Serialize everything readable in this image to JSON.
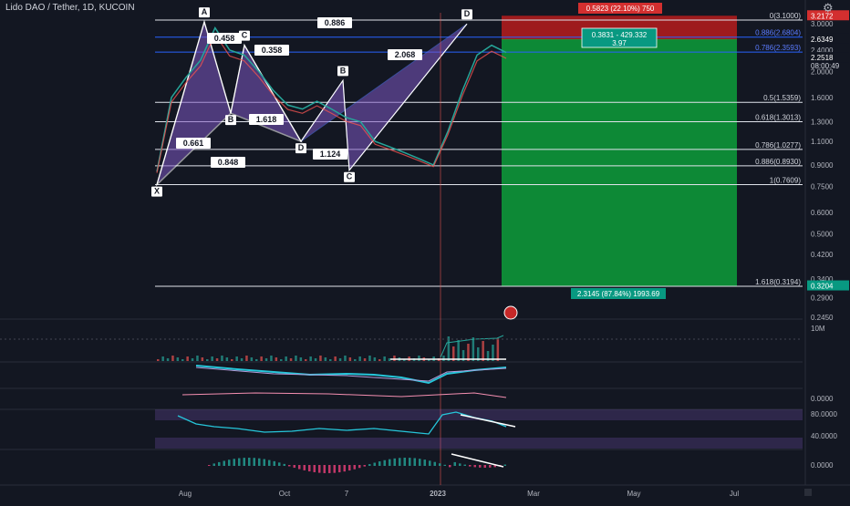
{
  "header": {
    "title": "Lido DAO / Tether, 1D, KUCOIN",
    "gear_icon": "gear-icon"
  },
  "clock": "08:00:49",
  "colors": {
    "background": "#131722",
    "harmonic_fill": "#7e57c2",
    "stop_zone": "#b71c1c",
    "target_zone": "#0d9e3a",
    "price_tag": "#d32f2f",
    "target_tag": "#089981",
    "fib_line": "#ffffff",
    "fib_line_blue": "#2962ff",
    "rsi_line": "#26c6da",
    "volume_line": "#26a69a"
  },
  "position": {
    "stop_label": "0.5823 (22.10%) 750",
    "entry_label_line1": "0.3831 - 429.332",
    "entry_label_line2": "3.97",
    "target_label": "2.3145 (87.84%) 1993.69"
  },
  "chart_data": {
    "type": "line",
    "title": "Lido DAO / Tether, 1D, KUCOIN",
    "y_scale": "log",
    "ylim": [
      0.245,
      3.3
    ],
    "price_axis_ticks": [
      "3.0000",
      "2.4000",
      "2.0000",
      "1.6000",
      "1.3000",
      "1.1000",
      "0.9000",
      "0.7500",
      "0.6000",
      "0.5000",
      "0.4200",
      "0.3400",
      "0.2900",
      "0.2450"
    ],
    "price_markers": [
      {
        "label": "3.2172",
        "color": "#d32f2f",
        "value": 3.2172
      },
      {
        "label": "2.6349",
        "color": "#131722",
        "value": 2.6349
      },
      {
        "label": "2.2518",
        "color": "#131722",
        "value": 2.2518
      },
      {
        "label": "0.3204",
        "color": "#089981",
        "value": 0.3204
      }
    ],
    "x_tick_labels": [
      "Aug",
      "Oct",
      "7",
      "2023",
      "Mar",
      "May",
      "Jul"
    ],
    "fib_levels": [
      {
        "label": "0(3.1000)",
        "value": 3.1
      },
      {
        "label": "0.886(2.6804)",
        "value": 2.6804,
        "color": "blue"
      },
      {
        "label": "0.786(2.3593)",
        "value": 2.3593,
        "color": "blue"
      },
      {
        "label": "0.5(1.5359)",
        "value": 1.5359
      },
      {
        "label": "0.618(1.3013)",
        "value": 1.3013
      },
      {
        "label": "0.786(1.0277)",
        "value": 1.0277
      },
      {
        "label": "0.886(0.8930)",
        "value": 0.893
      },
      {
        "label": "1(0.7609)",
        "value": 0.7609
      },
      {
        "label": "1.618(0.3194)",
        "value": 0.3194
      }
    ],
    "pattern_points": [
      {
        "label": "X",
        "value": 0.76
      },
      {
        "label": "A",
        "value": 3.05
      },
      {
        "label": "B",
        "value": 1.4
      },
      {
        "label": "C",
        "value": 2.5
      },
      {
        "label": "D",
        "value": 1.1
      },
      {
        "label": "B",
        "value": 1.85
      },
      {
        "label": "C",
        "value": 0.86
      },
      {
        "label": "D",
        "value": 3.0
      }
    ],
    "pattern_ratios": [
      "0.458",
      "1.618",
      "0.661",
      "0.848",
      "0.358",
      "1.124",
      "2.068",
      "0.886"
    ],
    "close_series": {
      "x": [
        "Jun 15",
        "Jun 25",
        "Jul 5",
        "Jul 15",
        "Jul 25",
        "Aug 5",
        "Aug 15",
        "Aug 25",
        "Sep 5",
        "Sep 15",
        "Sep 25",
        "Oct 5",
        "Oct 15",
        "Oct 25",
        "Nov 5",
        "Nov 15",
        "Nov 25",
        "Dec 5",
        "Dec 15",
        "Dec 25",
        "Jan 5",
        "Jan 15",
        "Jan 25",
        "Feb 5",
        "Feb 15"
      ],
      "y": [
        0.85,
        1.6,
        1.9,
        2.2,
        2.9,
        2.4,
        2.3,
        2.0,
        1.7,
        1.5,
        1.45,
        1.55,
        1.45,
        1.35,
        1.3,
        1.1,
        1.05,
        1.0,
        0.95,
        0.9,
        1.2,
        1.7,
        2.3,
        2.5,
        2.35
      ]
    },
    "indicators": [
      {
        "name": "volume",
        "axis_label": "10M"
      },
      {
        "name": "oscillator",
        "axis_label": "0.0000"
      },
      {
        "name": "rsi",
        "axis_labels": [
          "80.0000",
          "40.0000"
        ]
      },
      {
        "name": "macd_histogram",
        "axis_label": "0.0000"
      }
    ]
  }
}
